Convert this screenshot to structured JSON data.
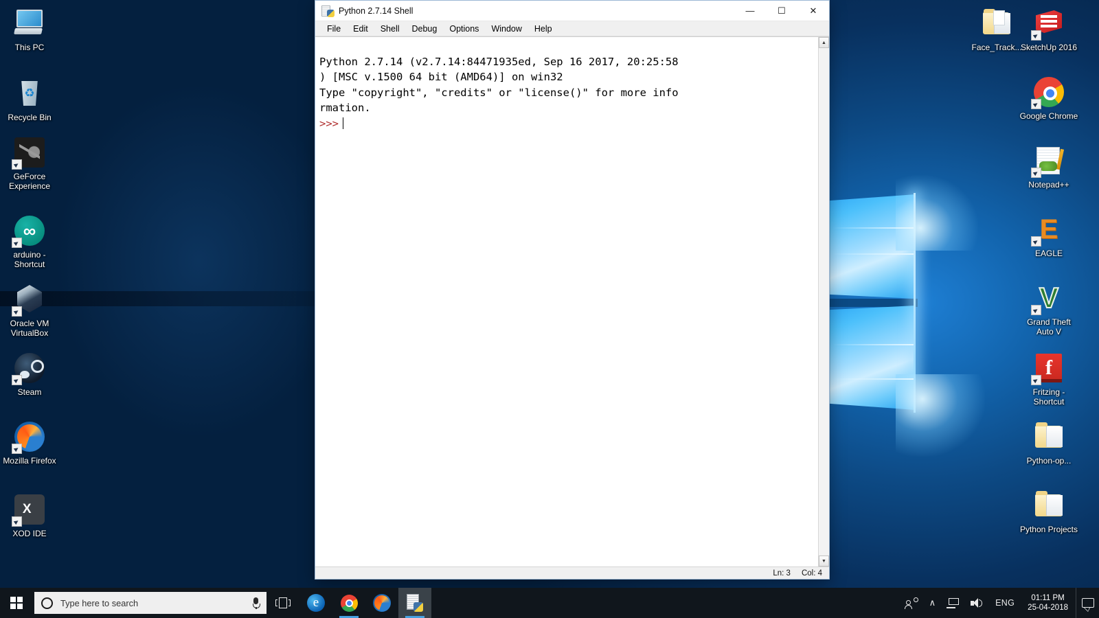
{
  "window": {
    "title": "Python 2.7.14 Shell",
    "icon": "python-shell-icon",
    "controls": {
      "minimize": "—",
      "maximize": "☐",
      "close": "✕"
    },
    "menu": [
      "File",
      "Edit",
      "Shell",
      "Debug",
      "Options",
      "Window",
      "Help"
    ],
    "shell": {
      "lines": [
        "Python 2.7.14 (v2.7.14:84471935ed, Sep 16 2017, 20:25:58",
        ") [MSC v.1500 64 bit (AMD64)] on win32",
        "Type \"copyright\", \"credits\" or \"license()\" for more info",
        "rmation."
      ],
      "prompt": ">>>"
    },
    "status": {
      "line": "Ln: 3",
      "col": "Col: 4"
    },
    "scrollbar": {
      "up": "▲",
      "down": "▼"
    }
  },
  "desktop": {
    "icons_left": [
      {
        "label": "This PC",
        "art": "this-pc",
        "shortcut": false
      },
      {
        "label": "Recycle Bin",
        "art": "recycle-bin",
        "shortcut": false
      },
      {
        "label": "GeForce Experience",
        "art": "geforce",
        "shortcut": true
      },
      {
        "label": "arduino - Shortcut",
        "art": "arduino",
        "shortcut": true
      },
      {
        "label": "Oracle VM VirtualBox",
        "art": "virtualbox",
        "shortcut": true
      },
      {
        "label": "Steam",
        "art": "steam",
        "shortcut": true
      },
      {
        "label": "Mozilla Firefox",
        "art": "firefox",
        "shortcut": true
      },
      {
        "label": "XOD IDE",
        "art": "xod",
        "shortcut": true
      }
    ],
    "icons_right_col1": [
      {
        "label": "Face_Track...",
        "art": "folder-face",
        "shortcut": false
      }
    ],
    "icons_right_col2": [
      {
        "label": "SketchUp 2016",
        "art": "sketchup",
        "shortcut": true
      },
      {
        "label": "Google Chrome",
        "art": "chrome",
        "shortcut": true
      },
      {
        "label": "Notepad++",
        "art": "notepadpp",
        "shortcut": true
      },
      {
        "label": "EAGLE",
        "art": "eagle",
        "shortcut": true
      },
      {
        "label": "Grand Theft Auto V",
        "art": "gtav",
        "shortcut": true
      },
      {
        "label": "Fritzing - Shortcut",
        "art": "fritzing",
        "shortcut": true
      },
      {
        "label": "Python-op...",
        "art": "folder-python-op",
        "shortcut": false
      },
      {
        "label": "Python Projects",
        "art": "folder-python-projects",
        "shortcut": false
      }
    ]
  },
  "taskbar": {
    "start": "start-button",
    "search": {
      "placeholder": "Type here to search",
      "icon": "search-icon",
      "mic": "microphone-icon"
    },
    "task_view": "task-view-button",
    "apps": [
      {
        "name": "microsoft-edge",
        "glyph": "e",
        "running": false
      },
      {
        "name": "google-chrome",
        "glyph": "",
        "running": true
      },
      {
        "name": "mozilla-firefox",
        "glyph": "",
        "running": false
      },
      {
        "name": "python-shell",
        "glyph": "",
        "running": true,
        "active": true
      }
    ],
    "tray": {
      "people": "people-icon",
      "show_hidden": "∧",
      "network": "network-icon",
      "volume": "volume-icon",
      "language": "ENG",
      "time": "01:11 PM",
      "date": "25-04-2018",
      "action_center": "action-center-icon"
    }
  }
}
